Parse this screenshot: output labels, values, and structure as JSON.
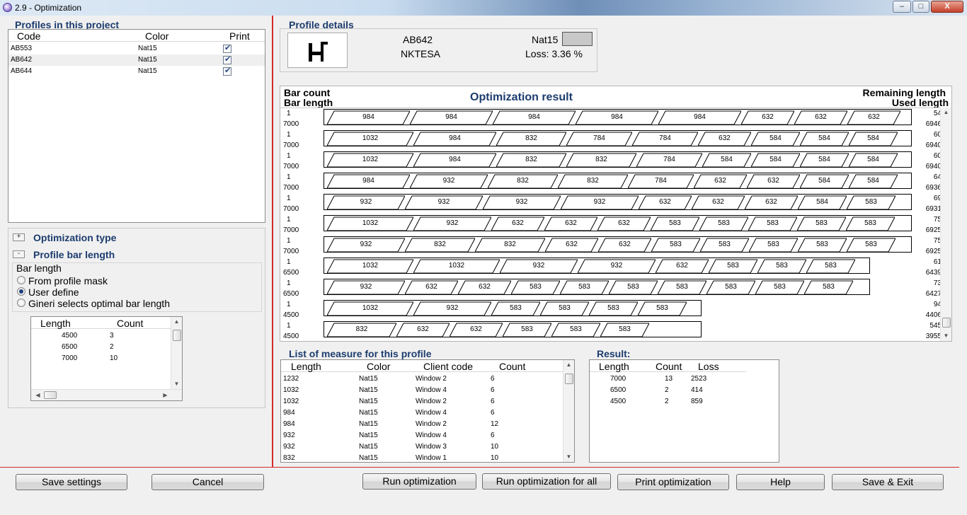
{
  "window": {
    "title": "2.9 - Optimization",
    "minimize": "–",
    "maximize": "□",
    "close": "X"
  },
  "profiles": {
    "title": "Profiles in this project",
    "columns": [
      "Code",
      "Color",
      "Print"
    ],
    "rows": [
      {
        "code": "AB553",
        "color": "Nat15",
        "print": true
      },
      {
        "code": "AB642",
        "color": "Nat15",
        "print": true
      },
      {
        "code": "AB644",
        "color": "Nat15",
        "print": true
      }
    ]
  },
  "optimization_type": {
    "title": "Optimization type",
    "toggle": "+"
  },
  "profile_bar_length": {
    "title": "Profile bar length",
    "toggle": "-",
    "group_label": "Bar length",
    "options": [
      {
        "label": "From profile mask",
        "selected": false
      },
      {
        "label": "User define",
        "selected": true
      },
      {
        "label": "Gineri selects optimal bar length",
        "selected": false
      }
    ],
    "table": {
      "columns": [
        "Length",
        "Count"
      ],
      "rows": [
        {
          "length": "4500",
          "count": "3"
        },
        {
          "length": "6500",
          "count": "2"
        },
        {
          "length": "7000",
          "count": "10"
        }
      ]
    }
  },
  "profile_details": {
    "title": "Profile details",
    "code": "AB642",
    "supplier": "NKTESA",
    "color": "Nat15",
    "color_swatch": "#c8c8c8",
    "loss": "Loss: 3.36 %"
  },
  "optimization_result": {
    "title": "Optimization result",
    "left_header_1": "Bar count",
    "left_header_2": "Bar length",
    "right_header_1": "Remaining length",
    "right_header_2": "Used length",
    "bars": [
      {
        "count": "1",
        "length": "7000",
        "remaining": "54",
        "used": "6946",
        "pieces": [
          "984",
          "984",
          "984",
          "984",
          "984",
          "632",
          "632",
          "632"
        ]
      },
      {
        "count": "1",
        "length": "7000",
        "remaining": "60",
        "used": "6940",
        "pieces": [
          "1032",
          "984",
          "832",
          "784",
          "784",
          "632",
          "584",
          "584",
          "584"
        ]
      },
      {
        "count": "1",
        "length": "7000",
        "remaining": "60",
        "used": "6940",
        "pieces": [
          "1032",
          "984",
          "832",
          "832",
          "784",
          "584",
          "584",
          "584",
          "584"
        ]
      },
      {
        "count": "1",
        "length": "7000",
        "remaining": "64",
        "used": "6936",
        "pieces": [
          "984",
          "932",
          "832",
          "832",
          "784",
          "632",
          "632",
          "584",
          "584"
        ]
      },
      {
        "count": "1",
        "length": "7000",
        "remaining": "69",
        "used": "6931",
        "pieces": [
          "932",
          "932",
          "932",
          "932",
          "632",
          "632",
          "632",
          "584",
          "583"
        ]
      },
      {
        "count": "1",
        "length": "7000",
        "remaining": "75",
        "used": "6925",
        "pieces": [
          "1032",
          "932",
          "632",
          "632",
          "632",
          "583",
          "583",
          "583",
          "583",
          "583"
        ]
      },
      {
        "count": "1",
        "length": "7000",
        "remaining": "75",
        "used": "6925",
        "pieces": [
          "932",
          "832",
          "832",
          "632",
          "632",
          "583",
          "583",
          "583",
          "583",
          "583"
        ]
      },
      {
        "count": "1",
        "length": "6500",
        "remaining": "61",
        "used": "6439",
        "pieces": [
          "1032",
          "1032",
          "932",
          "932",
          "632",
          "583",
          "583",
          "583"
        ]
      },
      {
        "count": "1",
        "length": "6500",
        "remaining": "73",
        "used": "6427",
        "pieces": [
          "932",
          "632",
          "632",
          "583",
          "583",
          "583",
          "583",
          "583",
          "583",
          "583"
        ]
      },
      {
        "count": "1",
        "length": "4500",
        "remaining": "94",
        "used": "4406",
        "pieces": [
          "1032",
          "932",
          "583",
          "583",
          "583",
          "583"
        ]
      },
      {
        "count": "1",
        "length": "4500",
        "remaining": "545",
        "used": "3955",
        "pieces": [
          "832",
          "632",
          "632",
          "583",
          "583",
          "583"
        ]
      }
    ]
  },
  "measures": {
    "title": "List of measure for this profile",
    "columns": [
      "Length",
      "Color",
      "Client code",
      "Count"
    ],
    "rows": [
      {
        "length": "1232",
        "color": "Nat15",
        "client": "Window 2",
        "count": "6"
      },
      {
        "length": "1032",
        "color": "Nat15",
        "client": "Window 4",
        "count": "6"
      },
      {
        "length": "1032",
        "color": "Nat15",
        "client": "Window 2",
        "count": "6"
      },
      {
        "length": "984",
        "color": "Nat15",
        "client": "Window 4",
        "count": "6"
      },
      {
        "length": "984",
        "color": "Nat15",
        "client": "Window 2",
        "count": "12"
      },
      {
        "length": "932",
        "color": "Nat15",
        "client": "Window 4",
        "count": "6"
      },
      {
        "length": "932",
        "color": "Nat15",
        "client": "Window 3",
        "count": "10"
      },
      {
        "length": "832",
        "color": "Nat15",
        "client": "Window 1",
        "count": "10"
      }
    ]
  },
  "result": {
    "title": "Result:",
    "columns": [
      "Length",
      "Count",
      "Loss"
    ],
    "rows": [
      {
        "length": "7000",
        "count": "13",
        "loss": "2523"
      },
      {
        "length": "6500",
        "count": "2",
        "loss": "414"
      },
      {
        "length": "4500",
        "count": "2",
        "loss": "859"
      }
    ]
  },
  "buttons": {
    "save_settings": "Save settings",
    "cancel": "Cancel",
    "run": "Run optimization",
    "run_all": "Run optimization for all",
    "print": "Print optimization",
    "help": "Help",
    "save_exit": "Save & Exit"
  }
}
